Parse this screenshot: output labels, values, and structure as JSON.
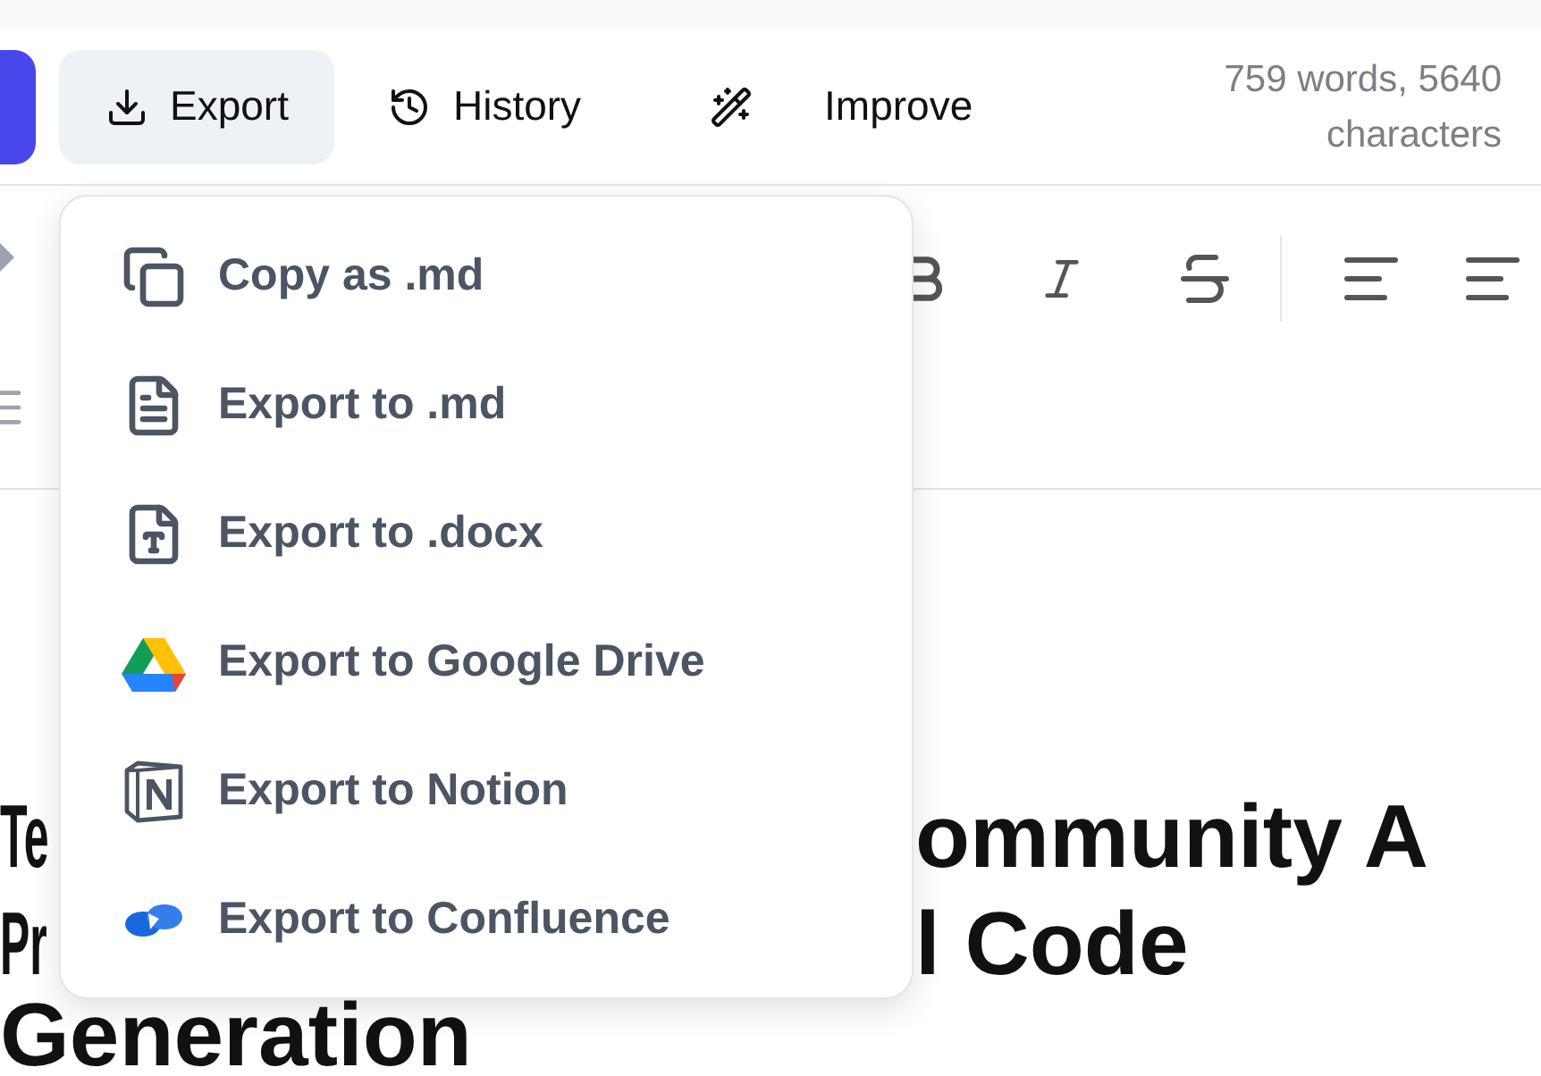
{
  "toolbar": {
    "buttons": [
      {
        "kind": "export",
        "label": "Export",
        "selected": true
      },
      {
        "kind": "history",
        "label": "History",
        "selected": false
      },
      {
        "kind": "improve",
        "label": "Improve",
        "selected": false
      }
    ],
    "stats": "759 words, 5640 characters"
  },
  "export_menu": {
    "items": [
      {
        "kind": "copy",
        "label": "Copy as .md"
      },
      {
        "kind": "markdown",
        "label": "Export to .md"
      },
      {
        "kind": "docx",
        "label": "Export to .docx"
      },
      {
        "kind": "drive",
        "label": "Export to Google Drive"
      },
      {
        "kind": "notion",
        "label": "Export to Notion"
      },
      {
        "kind": "confluence",
        "label": "Export to Confluence"
      }
    ]
  },
  "document": {
    "heading_lines": [
      [
        "Te",
        "ommunity A"
      ],
      [
        "Pr",
        "l Code"
      ],
      [
        "Generation"
      ]
    ]
  }
}
